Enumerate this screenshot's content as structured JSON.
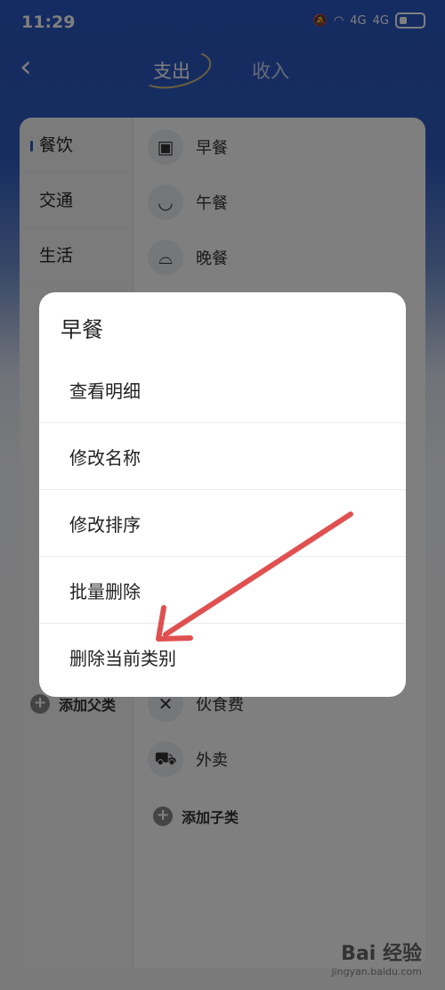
{
  "status": {
    "time": "11:29",
    "signal1": "4G",
    "signal2": "4G"
  },
  "header": {
    "back_icon": "chevron-left-icon",
    "tab_expense": "支出",
    "tab_income": "收入"
  },
  "categories": [
    {
      "label": "餐饮",
      "active": true
    },
    {
      "label": "交通",
      "active": false
    },
    {
      "label": "生活",
      "active": false
    }
  ],
  "add_parent_label": "添加父类",
  "subcategories": [
    {
      "label": "早餐",
      "icon": "toast-icon"
    },
    {
      "label": "午餐",
      "icon": "bowl-icon"
    },
    {
      "label": "晚餐",
      "icon": "cloche-icon"
    },
    {
      "label": "伙食费",
      "icon": "utensils-icon"
    },
    {
      "label": "外卖",
      "icon": "delivery-scooter-icon"
    }
  ],
  "add_child_label": "添加子类",
  "dialog": {
    "title": "早餐",
    "items": [
      {
        "label": "查看明细"
      },
      {
        "label": "修改名称"
      },
      {
        "label": "修改排序"
      },
      {
        "label": "批量删除"
      },
      {
        "label": "删除当前类别"
      }
    ]
  },
  "annotation": {
    "color": "#e05050"
  },
  "watermark": {
    "logo": "Bai 经验",
    "url": "jingyan.baidu.com"
  }
}
